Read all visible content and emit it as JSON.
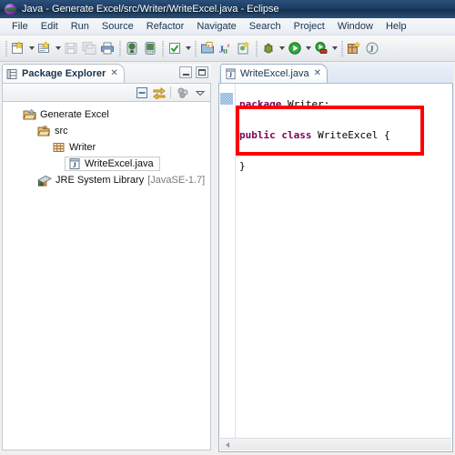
{
  "window": {
    "title": "Java - Generate Excel/src/Writer/WriteExcel.java - Eclipse",
    "app_icon": "eclipse-icon"
  },
  "menubar": {
    "items": [
      {
        "label": "File"
      },
      {
        "label": "Edit"
      },
      {
        "label": "Run"
      },
      {
        "label": "Source"
      },
      {
        "label": "Refactor"
      },
      {
        "label": "Navigate"
      },
      {
        "label": "Search"
      },
      {
        "label": "Project"
      },
      {
        "label": "Window"
      },
      {
        "label": "Help"
      }
    ]
  },
  "toolbar": {
    "buttons": [
      {
        "icon": "new-wizard-icon",
        "tooltip": "New"
      },
      {
        "icon": "new-java-class-icon",
        "tooltip": "New Java Class"
      },
      {
        "icon": "save-icon",
        "tooltip": "Save"
      },
      {
        "icon": "save-all-icon",
        "tooltip": "Save All"
      },
      {
        "icon": "print-icon",
        "tooltip": "Print"
      },
      {
        "icon": "android-sdk-manager-icon",
        "tooltip": "Android SDK Manager"
      },
      {
        "icon": "android-avd-manager-icon",
        "tooltip": "Android Virtual Device Manager"
      },
      {
        "icon": "checkmark-icon",
        "tooltip": "Toggle Mark Occurrences"
      },
      {
        "icon": "open-type-icon",
        "tooltip": "Open Type"
      },
      {
        "icon": "junit-icon",
        "tooltip": "New JUnit Test Case"
      },
      {
        "icon": "new-android-icon",
        "tooltip": "New Android Application"
      },
      {
        "icon": "debug-icon",
        "tooltip": "Debug"
      },
      {
        "icon": "run-icon",
        "tooltip": "Run"
      },
      {
        "icon": "external-tools-icon",
        "tooltip": "External Tools"
      },
      {
        "icon": "new-perspective-icon",
        "tooltip": "Open Perspective"
      },
      {
        "icon": "java-perspective-icon",
        "tooltip": "Java Perspective"
      }
    ]
  },
  "explorer": {
    "tab_label": "Package Explorer",
    "tab_icon": "package-explorer-icon",
    "close_glyph": "✕",
    "window_buttons": [
      {
        "name": "minimize",
        "tooltip": "Minimize"
      },
      {
        "name": "maximize",
        "tooltip": "Maximize"
      }
    ],
    "view_tools": [
      {
        "icon": "collapse-all-icon",
        "tooltip": "Collapse All"
      },
      {
        "icon": "link-with-editor-icon",
        "tooltip": "Link with Editor"
      },
      {
        "icon": "view-menu-filters-icon",
        "tooltip": "View Menu"
      },
      {
        "icon": "view-menu-chevron-icon",
        "tooltip": "View Menu"
      }
    ],
    "tree": [
      {
        "label": "Generate Excel",
        "icon": "java-project-icon",
        "indent": 0,
        "dim": "",
        "selected": false
      },
      {
        "label": "src",
        "icon": "source-folder-icon",
        "indent": 1,
        "dim": "",
        "selected": false
      },
      {
        "label": "Writer",
        "icon": "package-icon",
        "indent": 2,
        "dim": "",
        "selected": false
      },
      {
        "label": "WriteExcel.java",
        "icon": "java-file-icon",
        "indent": 3,
        "dim": "",
        "selected": true
      },
      {
        "label": "JRE System Library",
        "icon": "jre-library-icon",
        "indent": 1,
        "dim": "[JavaSE-1.7]",
        "selected": false
      }
    ]
  },
  "editor": {
    "tab_label": "WriteExcel.java",
    "tab_icon": "java-file-icon",
    "close_glyph": "✕",
    "code_lines": [
      {
        "indent": 0,
        "tokens": [
          {
            "t": "package ",
            "k": true
          },
          {
            "t": "Writer;",
            "k": false
          }
        ]
      },
      {
        "indent": 0,
        "tokens": []
      },
      {
        "indent": 0,
        "tokens": [
          {
            "t": "public class ",
            "k": true
          },
          {
            "t": "WriteExcel {",
            "k": false
          }
        ]
      },
      {
        "indent": 0,
        "tokens": []
      },
      {
        "indent": 0,
        "tokens": [
          {
            "t": "}",
            "k": false
          }
        ]
      }
    ],
    "scrollbar": {
      "name": "horizontal-scrollbar"
    }
  },
  "annotation": {
    "name": "red-highlight-rectangle",
    "color": "#ff0000",
    "target": "public class WriteExcel { }"
  },
  "colors": {
    "title_bar": "#1d3c61",
    "keyword": "#7f0055",
    "dim_text": "#7a7a7a",
    "annotation": "#ff0000"
  }
}
